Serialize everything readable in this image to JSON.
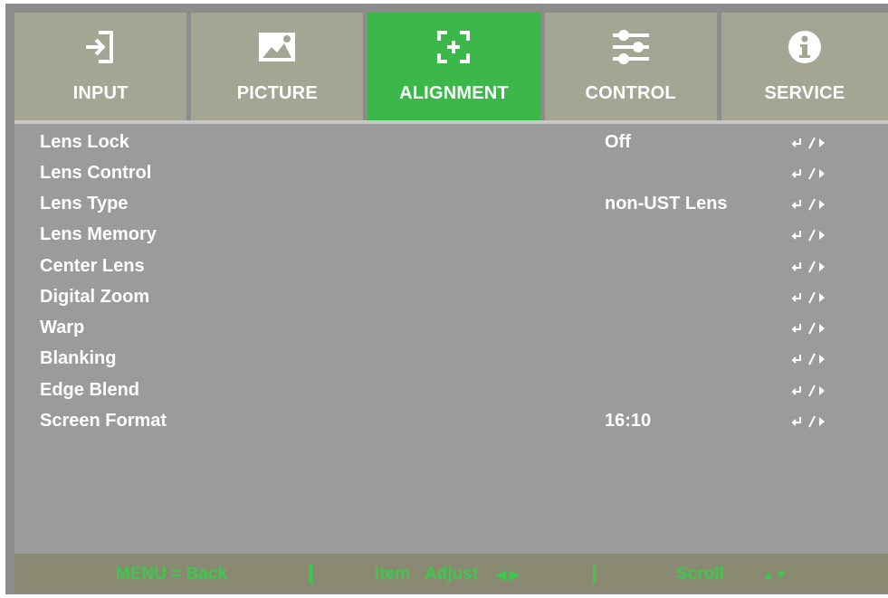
{
  "tabs": [
    {
      "label": "INPUT",
      "icon": "input-icon",
      "active": false
    },
    {
      "label": "PICTURE",
      "icon": "picture-icon",
      "active": false
    },
    {
      "label": "ALIGNMENT",
      "icon": "alignment-icon",
      "active": true
    },
    {
      "label": "CONTROL",
      "icon": "control-sliders-icon",
      "active": false
    },
    {
      "label": "SERVICE",
      "icon": "info-icon",
      "active": false
    }
  ],
  "menu": {
    "items": [
      {
        "name": "Lens Lock",
        "value": "Off"
      },
      {
        "name": "Lens Control",
        "value": ""
      },
      {
        "name": "Lens Type",
        "value": "non-UST Lens"
      },
      {
        "name": "Lens Memory",
        "value": ""
      },
      {
        "name": "Center Lens",
        "value": ""
      },
      {
        "name": "Digital Zoom",
        "value": ""
      },
      {
        "name": "Warp",
        "value": ""
      },
      {
        "name": "Blanking",
        "value": ""
      },
      {
        "name": "Edge Blend",
        "value": ""
      },
      {
        "name": "Screen Format",
        "value": "16:10"
      }
    ],
    "enter_icon": "enter-right-arrow-icon"
  },
  "footer": {
    "back": "MENU = Back",
    "item": "Item",
    "adjust": "Adjust",
    "adjust_arrows": "◀ ▶",
    "scroll": "Scroll",
    "scroll_arrows": "▲▼"
  },
  "colors": {
    "active_tab": "#3cb84a",
    "tab": "#a5a594",
    "menu_bg": "#9b9b9b",
    "footer_bg": "#8a8a72",
    "footer_text": "#3cc84c"
  }
}
